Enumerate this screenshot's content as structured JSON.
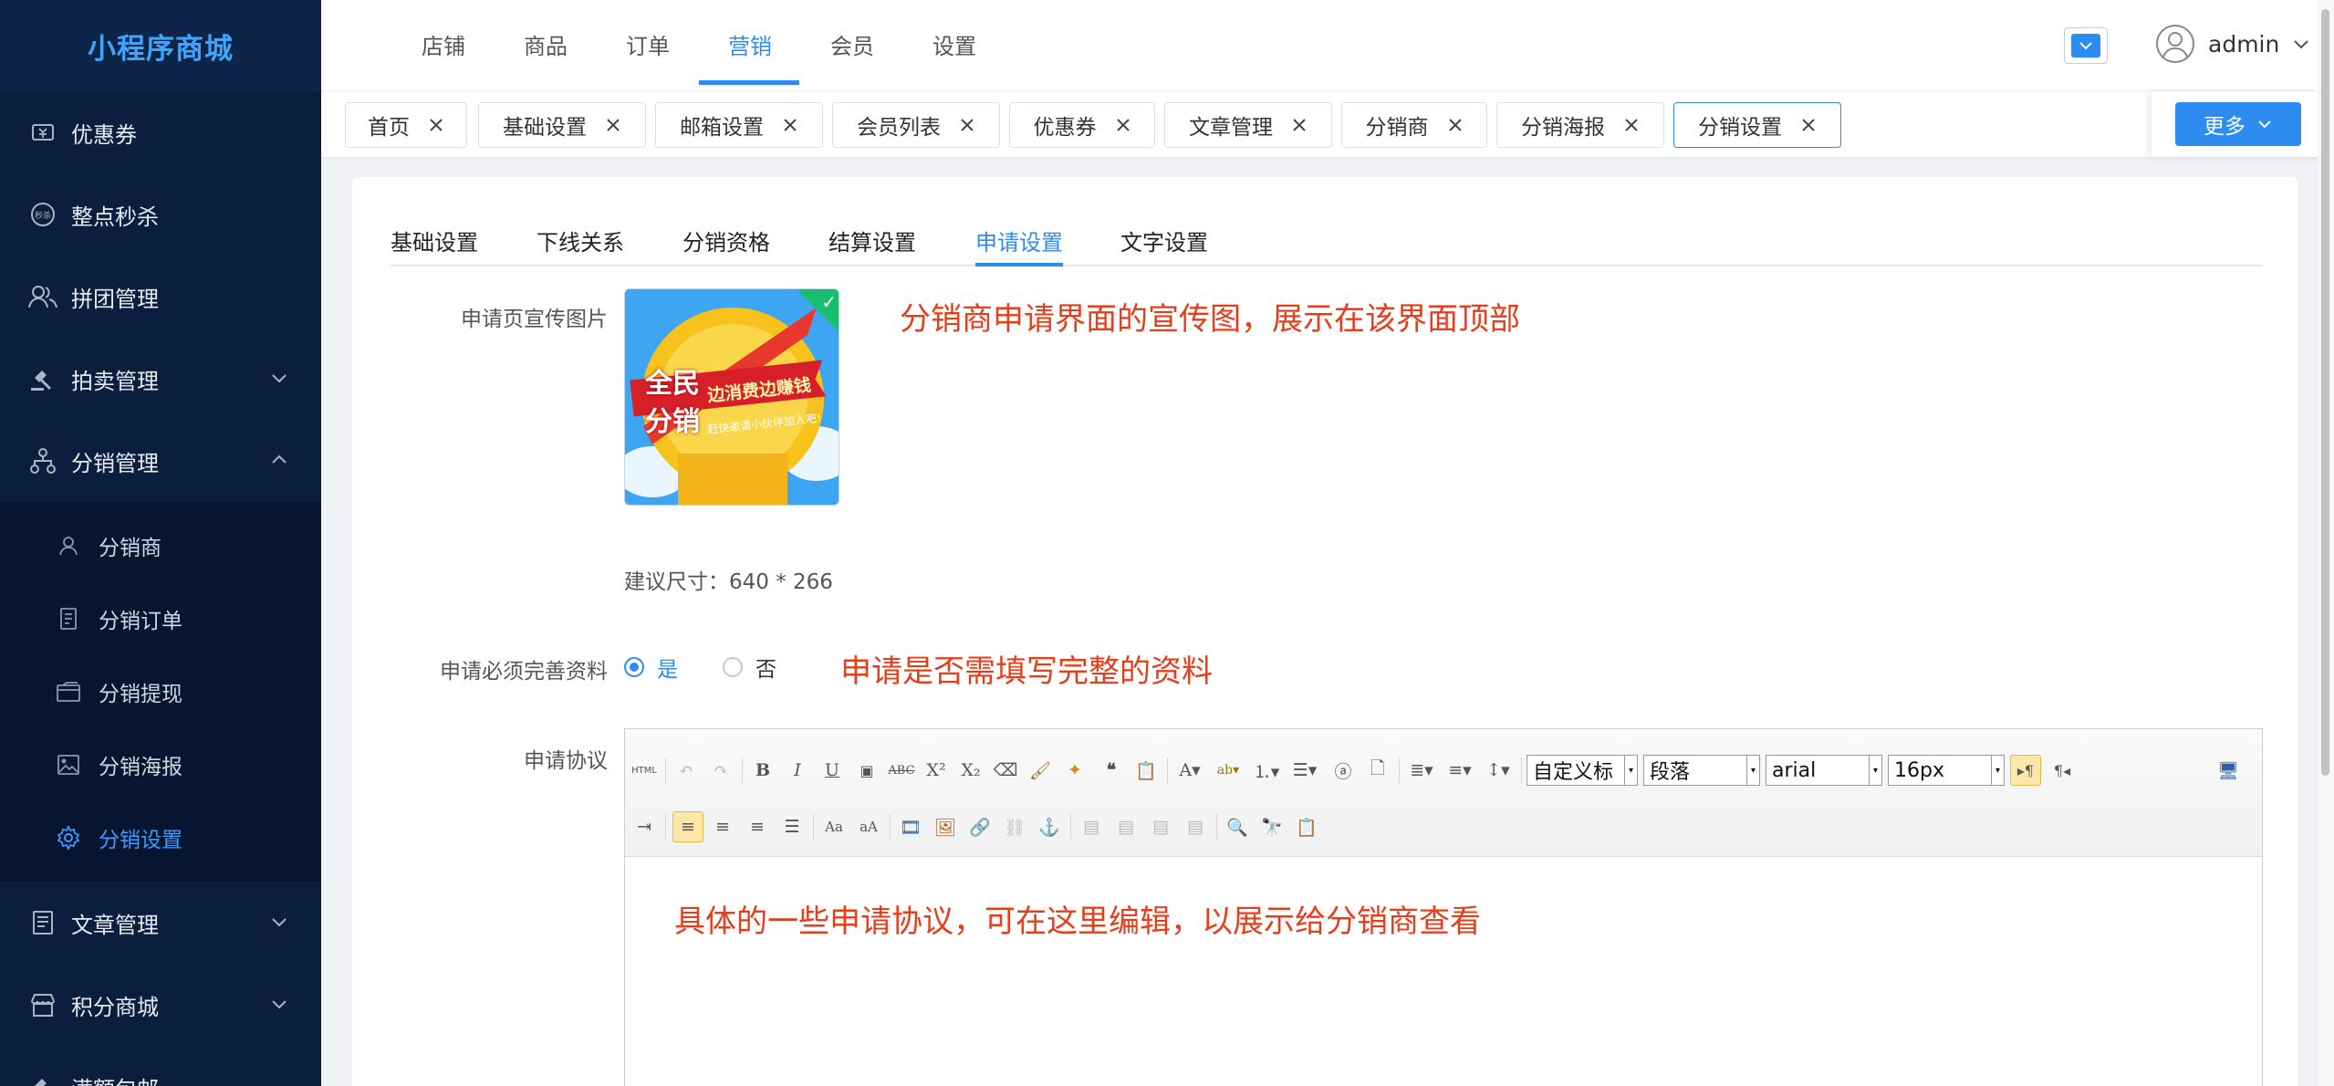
{
  "app": {
    "title": "小程序商城"
  },
  "sidebar": {
    "items": [
      {
        "label": "优惠券",
        "icon": "ticket-icon"
      },
      {
        "label": "整点秒杀",
        "icon": "flash-sale-icon"
      },
      {
        "label": "拼团管理",
        "icon": "group-icon"
      },
      {
        "label": "拍卖管理",
        "icon": "gavel-icon",
        "expandable": true
      },
      {
        "label": "分销管理",
        "icon": "org-tree-icon",
        "expanded": true
      }
    ],
    "sub_items": [
      {
        "label": "分销商",
        "icon": "user-icon"
      },
      {
        "label": "分销订单",
        "icon": "document-icon"
      },
      {
        "label": "分销提现",
        "icon": "wallet-icon"
      },
      {
        "label": "分销海报",
        "icon": "image-icon"
      },
      {
        "label": "分销设置",
        "icon": "gear-icon",
        "active": true
      }
    ],
    "items_after": [
      {
        "label": "文章管理",
        "icon": "article-icon",
        "expandable": true
      },
      {
        "label": "积分商城",
        "icon": "store-icon",
        "expandable": true
      },
      {
        "label": "满额包邮",
        "icon": "gavel-icon"
      }
    ]
  },
  "header": {
    "tabs": [
      "店铺",
      "商品",
      "订单",
      "营销",
      "会员",
      "设置"
    ],
    "active_tab": "营销",
    "user": "admin"
  },
  "tagbar": {
    "tags": [
      "首页",
      "基础设置",
      "邮箱设置",
      "会员列表",
      "优惠券",
      "文章管理",
      "分销商",
      "分销海报",
      "分销设置"
    ],
    "active_tag": "分销设置",
    "more_label": "更多"
  },
  "subtabs": {
    "items": [
      "基础设置",
      "下线关系",
      "分销资格",
      "结算设置",
      "申请设置",
      "文字设置"
    ],
    "active": "申请设置"
  },
  "form": {
    "poster_label": "申请页宣传图片",
    "poster_annotation": "分销商申请界面的宣传图，展示在该界面顶部",
    "poster_image": {
      "line1": "全民",
      "line2": "分销",
      "banner_title": "边消费边赚钱",
      "banner_sub": "赶快邀请小伙伴加入吧！"
    },
    "size_hint": "建议尺寸：640 * 266",
    "require_label": "申请必须完善资料",
    "require_options": [
      "是",
      "否"
    ],
    "require_selected": "是",
    "require_annotation": "申请是否需填写完整的资料",
    "agreement_label": "申请协议",
    "editor": {
      "combos": [
        "自定义标",
        "段落",
        "arial",
        "16px"
      ],
      "content": "具体的一些申请协议，可在这里编辑，以展示给分销商查看"
    }
  },
  "colors": {
    "sidebar_bg": "#0c1e3d",
    "accent": "#2d8cf0",
    "annotation": "#e83d1a"
  }
}
